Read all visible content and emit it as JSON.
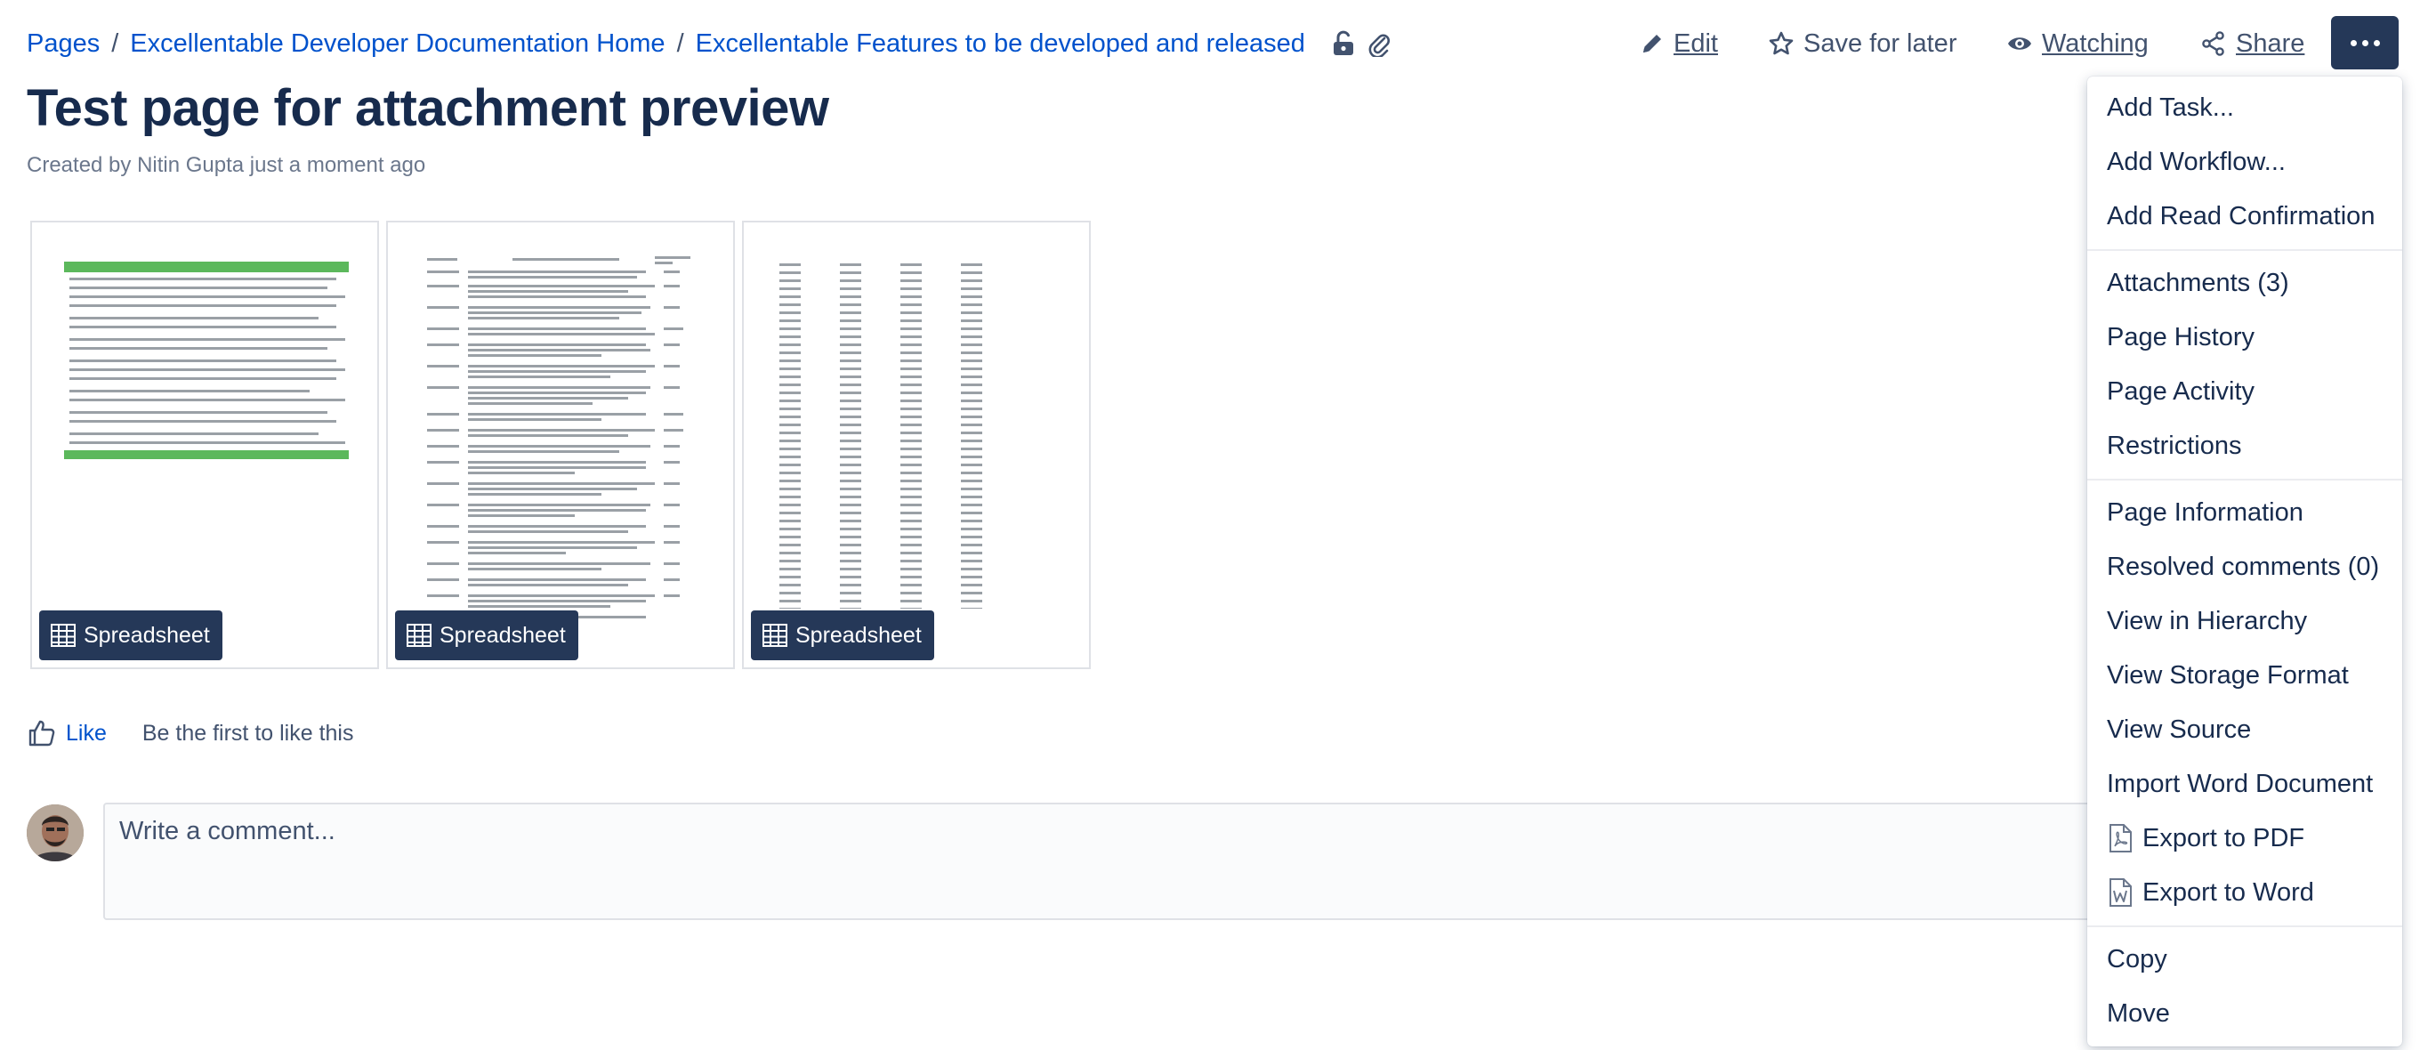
{
  "breadcrumb": {
    "items": [
      "Pages",
      "Excellentable Developer Documentation Home",
      "Excellentable Features to be developed and released"
    ],
    "icons": [
      "unlock-icon",
      "paperclip-icon"
    ]
  },
  "toolbar": {
    "edit": "Edit",
    "save_for_later": "Save for later",
    "watching": "Watching",
    "share": "Share",
    "more_icon": "more-dots-icon"
  },
  "page": {
    "title": "Test page for attachment preview",
    "byline": "Created by Nitin Gupta just a moment ago"
  },
  "attachments": [
    {
      "badge": "Spreadsheet",
      "icon": "spreadsheet-icon"
    },
    {
      "badge": "Spreadsheet",
      "icon": "spreadsheet-icon"
    },
    {
      "badge": "Spreadsheet",
      "icon": "spreadsheet-icon"
    }
  ],
  "like": {
    "label": "Like",
    "text": "Be the first to like this",
    "icon": "thumbs-up-icon"
  },
  "comment": {
    "placeholder": "Write a comment..."
  },
  "menu": {
    "groups": [
      [
        "Add Task...",
        "Add Workflow...",
        "Add Read Confirmation"
      ],
      [
        "Attachments (3)",
        "Page History",
        "Page Activity",
        "Restrictions"
      ],
      [
        "Page Information",
        "Resolved comments (0)",
        "View in Hierarchy",
        "View Storage Format",
        "View Source",
        "Import Word Document",
        "Export to PDF",
        "Export to Word"
      ],
      [
        "Copy",
        "Move"
      ]
    ]
  },
  "colors": {
    "link": "#0052cc",
    "text": "#172b4d",
    "subtle": "#6b778c",
    "dark_button": "#253858",
    "spreadsheet_header_green": "#5cb85c"
  }
}
